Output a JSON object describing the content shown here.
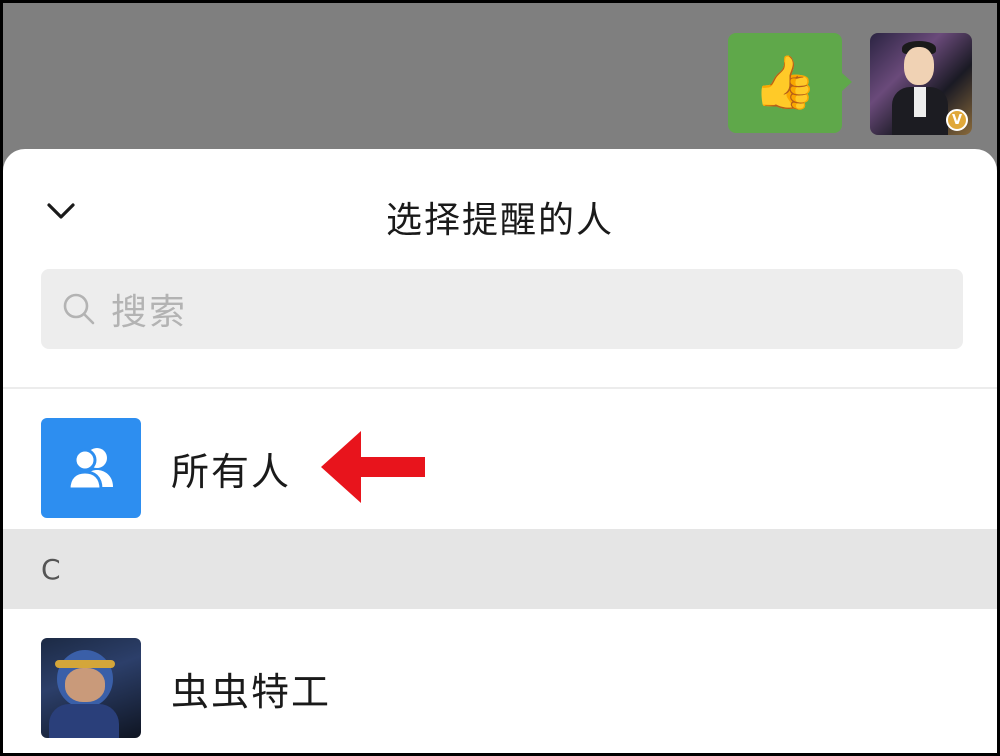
{
  "chat": {
    "bubble_icon": "thumbs-up-emoji",
    "bubble_emoji": "👍",
    "avatar_badge": "V"
  },
  "sheet": {
    "title": "选择提醒的人",
    "collapse_icon": "chevron-down-icon",
    "search": {
      "placeholder": "搜索",
      "icon": "search-icon"
    },
    "all_members": {
      "label": "所有人",
      "icon": "group-icon",
      "icon_color": "#2d8ef0"
    },
    "sections": [
      {
        "letter": "C",
        "contacts": [
          {
            "name": "虫虫特工"
          }
        ]
      }
    ]
  },
  "annotation": {
    "arrow_color": "#e8141c"
  }
}
